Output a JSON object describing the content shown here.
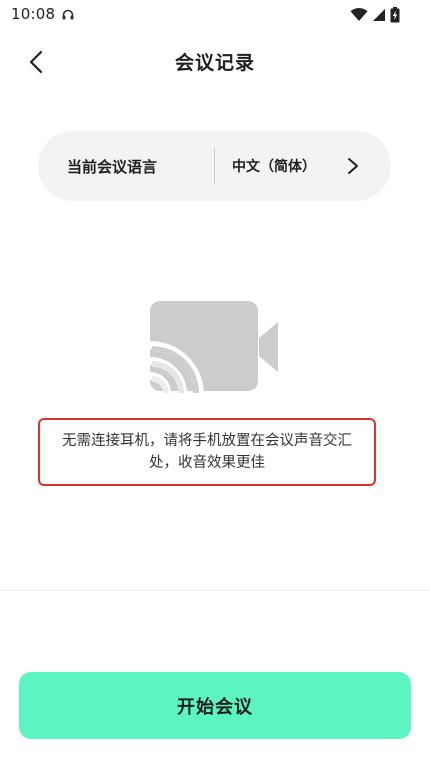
{
  "status_bar": {
    "time": "10:08"
  },
  "header": {
    "title": "会议记录"
  },
  "language_selector": {
    "label": "当前会议语言",
    "value": "中文（简体）"
  },
  "hint": {
    "text": "无需连接耳机，请将手机放置在会议声音交汇处，收音效果更佳",
    "highlight_color": "#d9352b"
  },
  "primary_action": {
    "label": "开始会议",
    "color": "#5cf5c1"
  },
  "icons": {
    "status_left": "headset-icon",
    "wifi": "wifi-icon",
    "signal": "signal-icon",
    "battery": "battery-charging-icon",
    "back": "back-arrow-icon",
    "chevron": "chevron-right-icon",
    "illustration": "cast-video-icon"
  }
}
